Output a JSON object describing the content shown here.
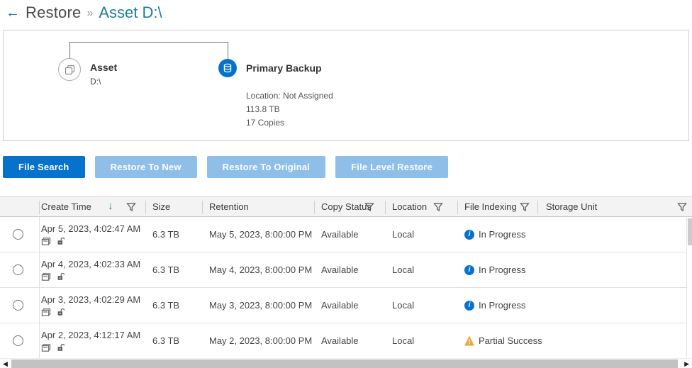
{
  "header": {
    "back_arrow": "←",
    "breadcrumb_root": "Restore",
    "separator": "»",
    "title": "Asset D:\\"
  },
  "copy_map": {
    "asset": {
      "label": "Asset",
      "name": "D:\\"
    },
    "primary_backup": {
      "label": "Primary Backup",
      "location": "Location: Not Assigned",
      "size": "113.8 TB",
      "copies": "17 Copies"
    }
  },
  "actions": [
    {
      "label": "File Search",
      "enabled": true
    },
    {
      "label": "Restore To New",
      "enabled": false
    },
    {
      "label": "Restore To Original",
      "enabled": false
    },
    {
      "label": "File Level Restore",
      "enabled": false
    }
  ],
  "table": {
    "columns": [
      "Create Time",
      "Size",
      "Retention",
      "Copy Status",
      "Location",
      "File Indexing",
      "Storage Unit"
    ],
    "sort": {
      "column": "Create Time",
      "direction": "descending",
      "glyph": "↓"
    },
    "rows": [
      {
        "create_time": "Apr 5, 2023, 4:02:47 AM",
        "size": "6.3 TB",
        "retention": "May 5, 2023, 8:00:00 PM",
        "copy_status": "Available",
        "location": "Local",
        "file_indexing": "In Progress",
        "indexing_icon": "info",
        "storage_unit": ""
      },
      {
        "create_time": "Apr 4, 2023, 4:02:33 AM",
        "size": "6.3 TB",
        "retention": "May 4, 2023, 8:00:00 PM",
        "copy_status": "Available",
        "location": "Local",
        "file_indexing": "In Progress",
        "indexing_icon": "info",
        "storage_unit": ""
      },
      {
        "create_time": "Apr 3, 2023, 4:02:29 AM",
        "size": "6.3 TB",
        "retention": "May 3, 2023, 8:00:00 PM",
        "copy_status": "Available",
        "location": "Local",
        "file_indexing": "In Progress",
        "indexing_icon": "info",
        "storage_unit": ""
      },
      {
        "create_time": "Apr 2, 2023, 4:12:17 AM",
        "size": "6.3 TB",
        "retention": "May 2, 2023, 8:00:00 PM",
        "copy_status": "Available",
        "location": "Local",
        "file_indexing": "Partial Success",
        "indexing_icon": "warning",
        "storage_unit": ""
      }
    ]
  },
  "icons": {
    "info_glyph": "i",
    "warning_glyph": "!",
    "scroll_left": "◀",
    "scroll_right": "▶"
  },
  "colors": {
    "accent_blue": "#0672cb",
    "disabled_blue": "#8fbfe8",
    "title_teal": "#1d7b9e",
    "warning_amber": "#e9a93b",
    "text_dark": "#444444",
    "header_bg": "#f3f3f3"
  }
}
